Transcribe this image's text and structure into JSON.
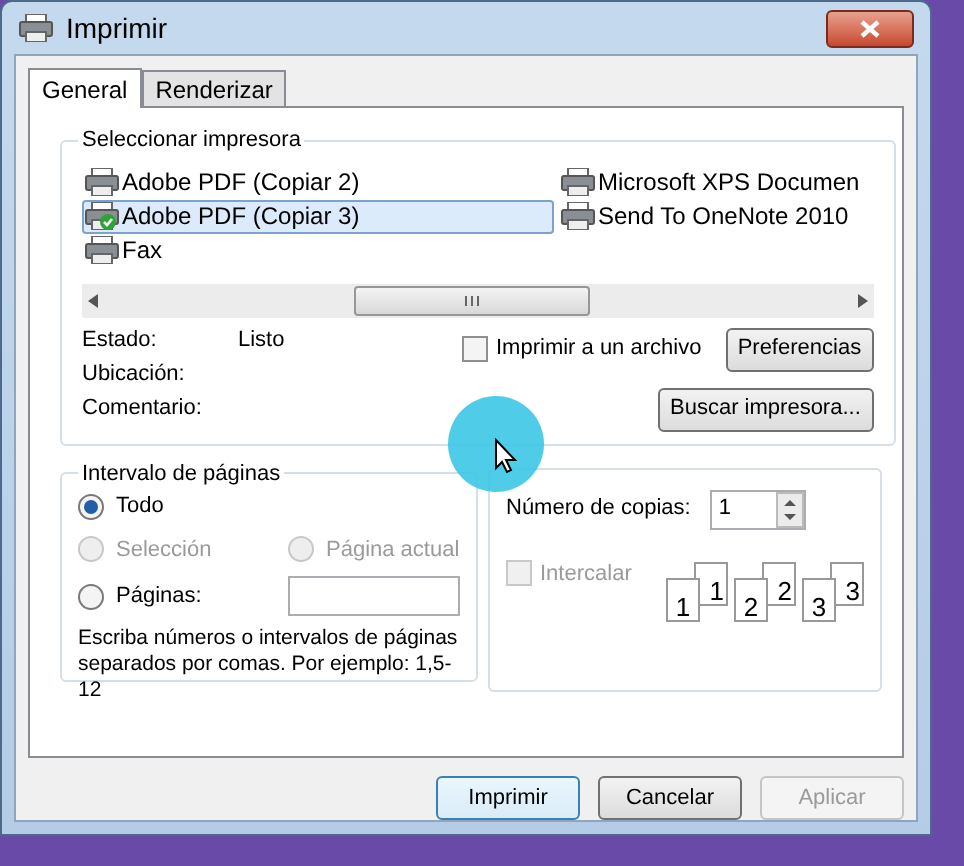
{
  "window": {
    "title": "Imprimir"
  },
  "tabs": [
    {
      "label": "General",
      "selected": true
    },
    {
      "label": "Renderizar",
      "selected": false
    }
  ],
  "printer_group": {
    "title": "Seleccionar impresora",
    "printers": [
      {
        "name": "Adobe PDF (Copiar 2)",
        "selected": false,
        "default": false
      },
      {
        "name": "Adobe PDF (Copiar 3)",
        "selected": true,
        "default": true
      },
      {
        "name": "Fax",
        "selected": false,
        "default": false
      },
      {
        "name": "Microsoft XPS Documen",
        "selected": false,
        "default": false
      },
      {
        "name": "Send To OneNote 2010",
        "selected": false,
        "default": false
      }
    ],
    "details": [
      {
        "label": "Estado:",
        "value": "Listo"
      },
      {
        "label": "Ubicación:"
      },
      {
        "label": "Comentario:"
      }
    ],
    "print_to_file": {
      "label": "Imprimir a un archivo",
      "checked": false
    },
    "preferences_button": "Preferencias",
    "find_button": "Buscar impresora..."
  },
  "page_range": {
    "title": "Intervalo de páginas",
    "options": [
      {
        "label": "Todo",
        "selected": true,
        "disabled": false
      },
      {
        "label": "Selección",
        "selected": false,
        "disabled": true
      },
      {
        "label": "Página actual",
        "selected": false,
        "disabled": true
      },
      {
        "label": "Páginas:",
        "selected": false,
        "disabled": false
      }
    ],
    "hint": "Escriba números o intervalos de páginas separados por comas. Por ejemplo: 1,5-12"
  },
  "copies": {
    "label": "Número de copias:",
    "value": "1",
    "collate": {
      "label": "Intercalar",
      "checked": false,
      "disabled": true
    },
    "pages": [
      {
        "front": "1",
        "back": "1"
      },
      {
        "front": "2",
        "back": "2"
      },
      {
        "front": "3",
        "back": "3"
      }
    ]
  },
  "buttons": [
    {
      "label": "Imprimir",
      "disabled": false,
      "default": true
    },
    {
      "label": "Cancelar",
      "disabled": false,
      "default": false
    },
    {
      "label": "Aplicar",
      "disabled": true,
      "default": false
    }
  ]
}
